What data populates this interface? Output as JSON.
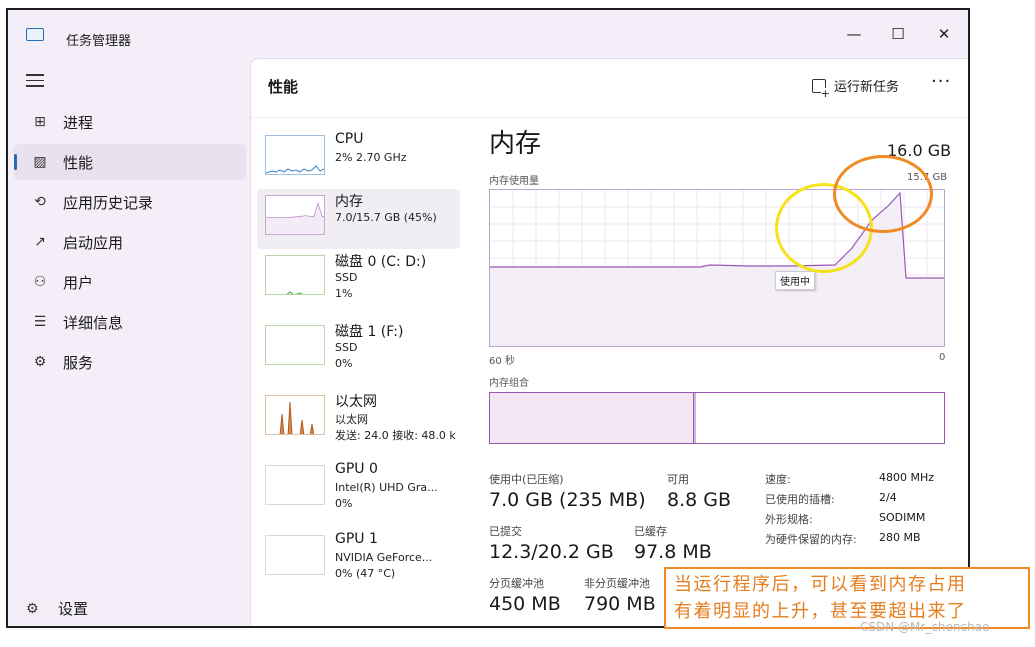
{
  "window": {
    "title": "任务管理器",
    "minimize": "—",
    "maximize": "☐",
    "close": "✕"
  },
  "sidebar": {
    "items": [
      {
        "label": "进程",
        "icon": "processes-icon",
        "glyph": "⊞"
      },
      {
        "label": "性能",
        "icon": "performance-icon",
        "glyph": "▨"
      },
      {
        "label": "应用历史记录",
        "icon": "app-history-icon",
        "glyph": "⟲"
      },
      {
        "label": "启动应用",
        "icon": "startup-icon",
        "glyph": "↗"
      },
      {
        "label": "用户",
        "icon": "users-icon",
        "glyph": "⚇"
      },
      {
        "label": "详细信息",
        "icon": "details-icon",
        "glyph": "☰"
      },
      {
        "label": "服务",
        "icon": "services-icon",
        "glyph": "⚙"
      }
    ],
    "active": "性能",
    "settings": {
      "label": "设置",
      "glyph": "⚙"
    }
  },
  "header": {
    "title": "性能",
    "run_task": "运行新任务",
    "more": "···"
  },
  "devices": [
    {
      "name": "CPU",
      "line2": "2% 2.70 GHz",
      "line3": "",
      "line4": ""
    },
    {
      "name": "内存",
      "line2": "7.0/15.7 GB (45%)",
      "line3": "",
      "line4": ""
    },
    {
      "name": "磁盘 0 (C: D:)",
      "line2": "SSD",
      "line3": "1%",
      "line4": ""
    },
    {
      "name": "磁盘 1 (F:)",
      "line2": "SSD",
      "line3": "0%",
      "line4": ""
    },
    {
      "name": "以太网",
      "line2": "以太网",
      "line3": "发送: 24.0  接收: 48.0 k",
      "line4": ""
    },
    {
      "name": "GPU 0",
      "line2": "Intel(R) UHD Gra...",
      "line3": "0%",
      "line4": ""
    },
    {
      "name": "GPU 1",
      "line2": "NVIDIA GeForce...",
      "line3": "0% (47 °C)",
      "line4": ""
    }
  ],
  "detail": {
    "title": "内存",
    "total": "16.0 GB",
    "usage_label": "内存使用量",
    "graph_max": "15.7 GB",
    "x_left": "60 秒",
    "x_right": "0",
    "tooltip": "使用中",
    "composition_label": "内存组合",
    "composition_used_fraction": 0.45,
    "stats": [
      {
        "label": "使用中(已压缩)",
        "value": "7.0 GB (235 MB)"
      },
      {
        "label": "可用",
        "value": "8.8 GB"
      },
      {
        "label": "已提交",
        "value": "12.3/20.2 GB"
      },
      {
        "label": "已缓存",
        "value": "97.8 MB"
      },
      {
        "label": "分页缓冲池",
        "value": "450 MB"
      },
      {
        "label": "非分页缓冲池",
        "value": "790 MB"
      }
    ],
    "kv": [
      {
        "label": "速度:",
        "value": "4800 MHz"
      },
      {
        "label": "已使用的插槽:",
        "value": "2/4"
      },
      {
        "label": "外形规格:",
        "value": "SODIMM"
      },
      {
        "label": "为硬件保留的内存:",
        "value": "280 MB"
      }
    ]
  },
  "annotation": {
    "line1": "当运行程序后，可以看到内存占用",
    "line2": "有着明显的上升，甚至要超出来了"
  },
  "watermark": "CSDN @Mr_chenchao",
  "colors": {
    "memory": "#9b57b3",
    "accent": "#2b6cb0",
    "yellow_circle": "#f4e21a",
    "orange_circle": "#f08a24",
    "note": "#e57d1c"
  }
}
